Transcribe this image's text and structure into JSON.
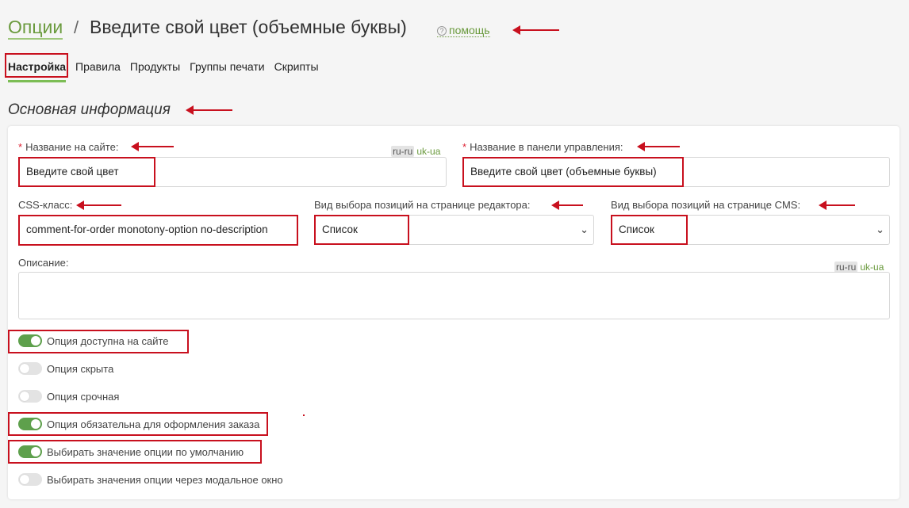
{
  "header": {
    "breadcrumb": "Опции",
    "separator": "/",
    "title": "Введите свой цвет (объемные буквы)",
    "help_label": "помощь"
  },
  "tabs": [
    {
      "label": "Настройка",
      "active": true
    },
    {
      "label": "Правила"
    },
    {
      "label": "Продукты"
    },
    {
      "label": "Группы печати"
    },
    {
      "label": "Скрипты"
    }
  ],
  "section_title": "Основная информация",
  "form": {
    "site_name": {
      "label": "Название на сайте:",
      "value": "Введите свой цвет"
    },
    "admin_name": {
      "label": "Название в панели управления:",
      "value": "Введите свой цвет (объемные буквы)"
    },
    "css_class": {
      "label": "CSS-класс:",
      "value": "comment-for-order monotony-option no-description"
    },
    "editor_select": {
      "label": "Вид выбора позиций на странице редактора:",
      "value": "Список"
    },
    "cms_select": {
      "label": "Вид выбора позиций на странице CMS:",
      "value": "Список"
    },
    "description": {
      "label": "Описание:",
      "value": ""
    },
    "lang_active": "ru-ru",
    "lang_other": "uk-ua"
  },
  "toggles": [
    {
      "label": "Опция доступна на сайте",
      "on": true
    },
    {
      "label": "Опция скрыта",
      "on": false
    },
    {
      "label": "Опция срочная",
      "on": false
    },
    {
      "label": "Опция обязательна для оформления заказа",
      "on": true
    },
    {
      "label": "Выбирать значение опции по умолчанию",
      "on": true
    },
    {
      "label": "Выбирать значения опции через модальное окно",
      "on": false
    }
  ],
  "colors": {
    "accent": "#6a9a3d",
    "toggle_on": "#5ea04c",
    "annotation": "#c8101e"
  }
}
